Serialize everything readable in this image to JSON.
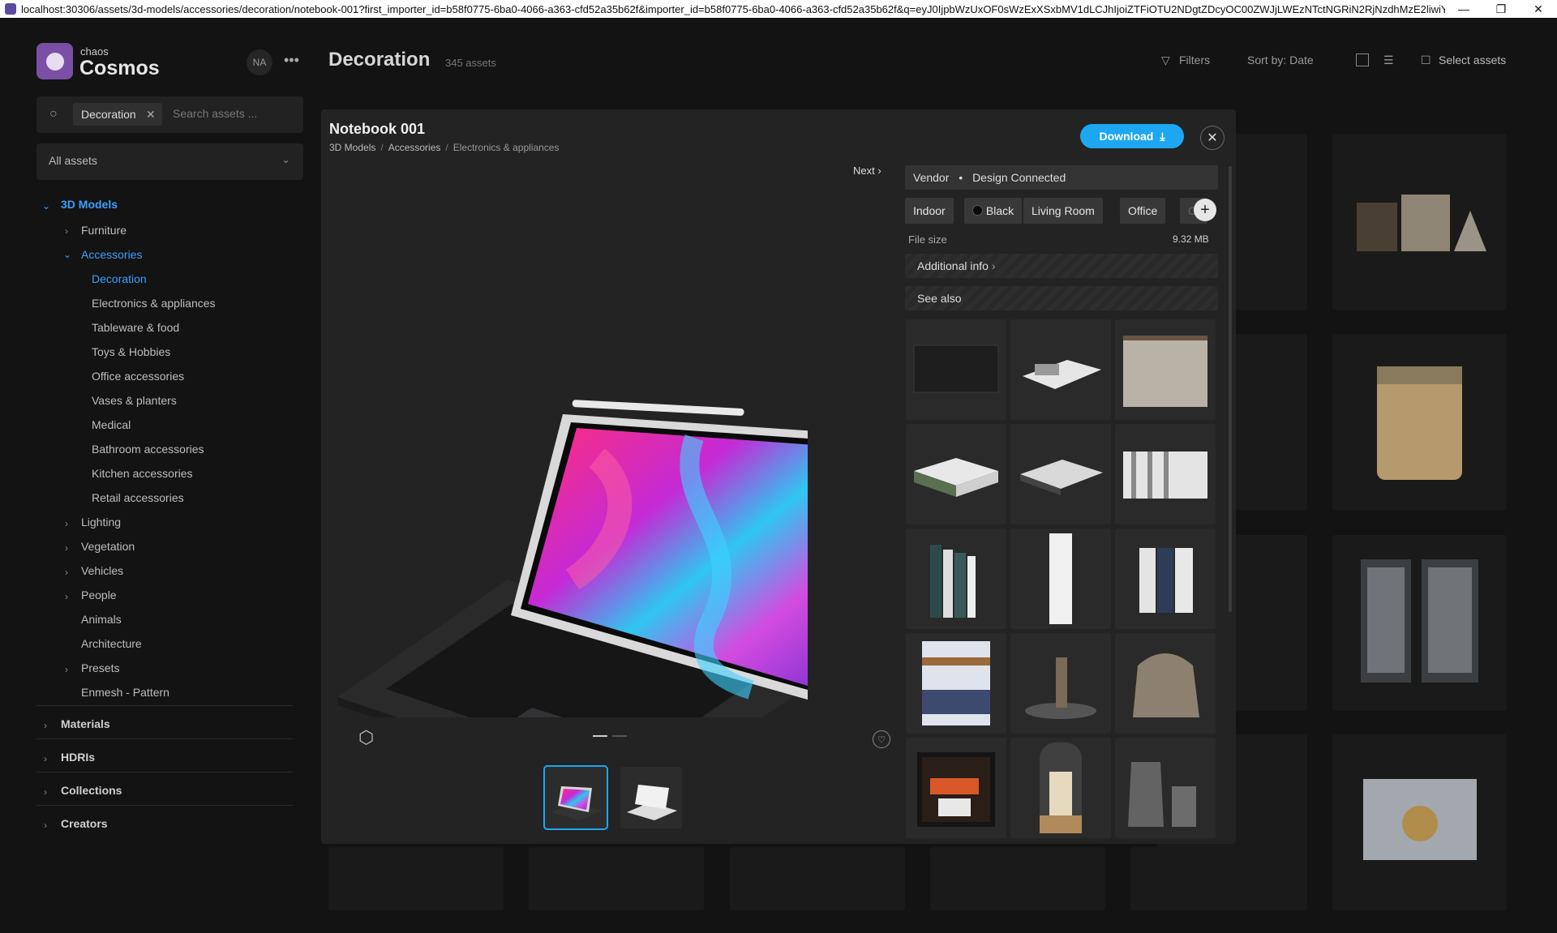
{
  "browser": {
    "url": "localhost:30306/assets/3d-models/accessories/decoration/notebook-001?first_importer_id=b58f0775-6ba0-4066-a363-cfd52a35b62f&importer_id=b58f0775-6ba0-4066-a363-cfd52a35b62f&q=eyJ0IjpbWzUxOF0sWzExXSxbMV1dLCJhIjoiZTFiOTU2NDgtZDcyOC00ZWJjLWEzNTctNGRiN2RjNzdhMzE2liwiYyl6MX0&utm_medium=Cin..."
  },
  "brand": {
    "small": "chaos",
    "big": "Cosmos"
  },
  "user": {
    "initials": "NA"
  },
  "search": {
    "chip": "Decoration",
    "placeholder": "Search assets ..."
  },
  "filter_select": "All assets",
  "tree": {
    "root": "3D Models",
    "items": [
      "Furniture",
      "Accessories"
    ],
    "sub": [
      "Decoration",
      "Electronics & appliances",
      "Tableware & food",
      "Toys & Hobbies",
      "Office accessories",
      "Vases & planters",
      "Medical",
      "Bathroom accessories",
      "Kitchen accessories",
      "Retail accessories"
    ],
    "rest": [
      "Lighting",
      "Vegetation",
      "Vehicles",
      "People",
      "Animals",
      "Architecture",
      "Presets",
      "Enmesh - Pattern"
    ],
    "sections": [
      "Materials",
      "HDRIs",
      "Collections",
      "Creators"
    ]
  },
  "header": {
    "title": "Decoration",
    "count": "345 assets",
    "filters": "Filters",
    "sort": "Sort by: Date",
    "select": "Select assets"
  },
  "modal": {
    "title": "Notebook 001",
    "breadcrumb": [
      "3D Models",
      "Accessories",
      "Electronics & appliances"
    ],
    "download": "Download",
    "next": "Next",
    "vendor_label": "Vendor",
    "vendor_name": "Design Connected",
    "tags": [
      "Indoor",
      "Black",
      "Living Room",
      "Office",
      "C"
    ],
    "file_size_label": "File size",
    "file_size_value": "9.32 MB",
    "additional_info": "Additional info",
    "see_also": "See also"
  },
  "colors": {
    "accent": "#1da7f0",
    "tree_active": "#3aa0ff"
  }
}
